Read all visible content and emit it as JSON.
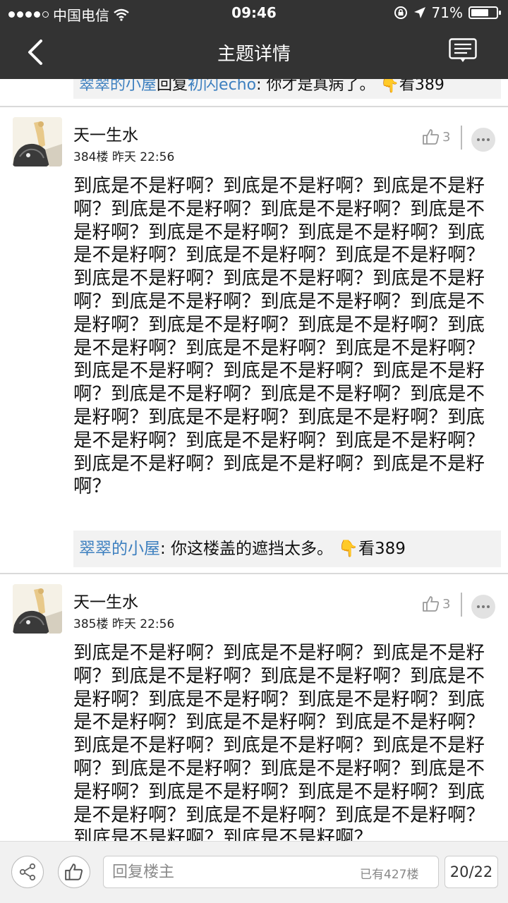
{
  "status_bar": {
    "carrier": "中国电信",
    "time": "09:46",
    "battery_percent": "71%",
    "battery_level": 0.71,
    "signal_dots_filled": 4,
    "signal_dots_total": 5
  },
  "nav": {
    "title": "主题详情",
    "back_icon": "chevron-left-icon",
    "menu_icon": "comment-list-icon"
  },
  "top_quote": {
    "user": "翠翠的小屋",
    "verb": "回复",
    "target": "初闪echo",
    "text": ": 你才是真病了。",
    "view_label": "看389"
  },
  "posts": [
    {
      "author": "天一生水",
      "floor": "384楼",
      "date": "昨天 22:56",
      "likes": "3",
      "body": "到底是不是籽啊？到底是不是籽啊？到底是不是籽啊？到底是不是籽啊？到底是不是籽啊？到底是不是籽啊？到底是不是籽啊？到底是不是籽啊？到底是不是籽啊？到底是不是籽啊？到底是不是籽啊？到底是不是籽啊？到底是不是籽啊？到底是不是籽啊？到底是不是籽啊？到底是不是籽啊？到底是不是籽啊？到底是不是籽啊？到底是不是籽啊？到底是不是籽啊？到底是不是籽啊？到底是不是籽啊？到底是不是籽啊？到底是不是籽啊？到底是不是籽啊？到底是不是籽啊？到底是不是籽啊？到底是不是籽啊？到底是不是籽啊？到底是不是籽啊？到底是不是籽啊？到底是不是籽啊？到底是不是籽啊？到底是不是籽啊？到底是不是籽啊？到底是不是籽啊？",
      "reply": {
        "user": "翠翠的小屋",
        "text": ": 你这楼盖的遮挡太多。",
        "view_label": "看389"
      }
    },
    {
      "author": "天一生水",
      "floor": "385楼",
      "date": "昨天 22:56",
      "likes": "3",
      "body": "到底是不是籽啊？到底是不是籽啊？到底是不是籽啊？到底是不是籽啊？到底是不是籽啊？到底是不是籽啊？到底是不是籽啊？到底是不是籽啊？到底是不是籽啊？到底是不是籽啊？到底是不是籽啊？到底是不是籽啊？到底是不是籽啊？到底是不是籽啊？到底是不是籽啊？到底是不是籽啊？到底是不是籽啊？到底是不是籽啊？到底是不是籽啊？到底是不是籽啊？到底是不是籽啊？到底是不是籽啊？到底是不是籽啊？到底是不是籽啊？"
    }
  ],
  "bottom_bar": {
    "reply_placeholder": "回复楼主",
    "floor_count": "已有427楼",
    "page": "20/22",
    "share_icon": "share-icon",
    "like_icon": "thumbs-up-icon"
  },
  "colors": {
    "bar_bg": "#333333",
    "username": "#3c7fbf",
    "emoji": "#f2a620"
  }
}
